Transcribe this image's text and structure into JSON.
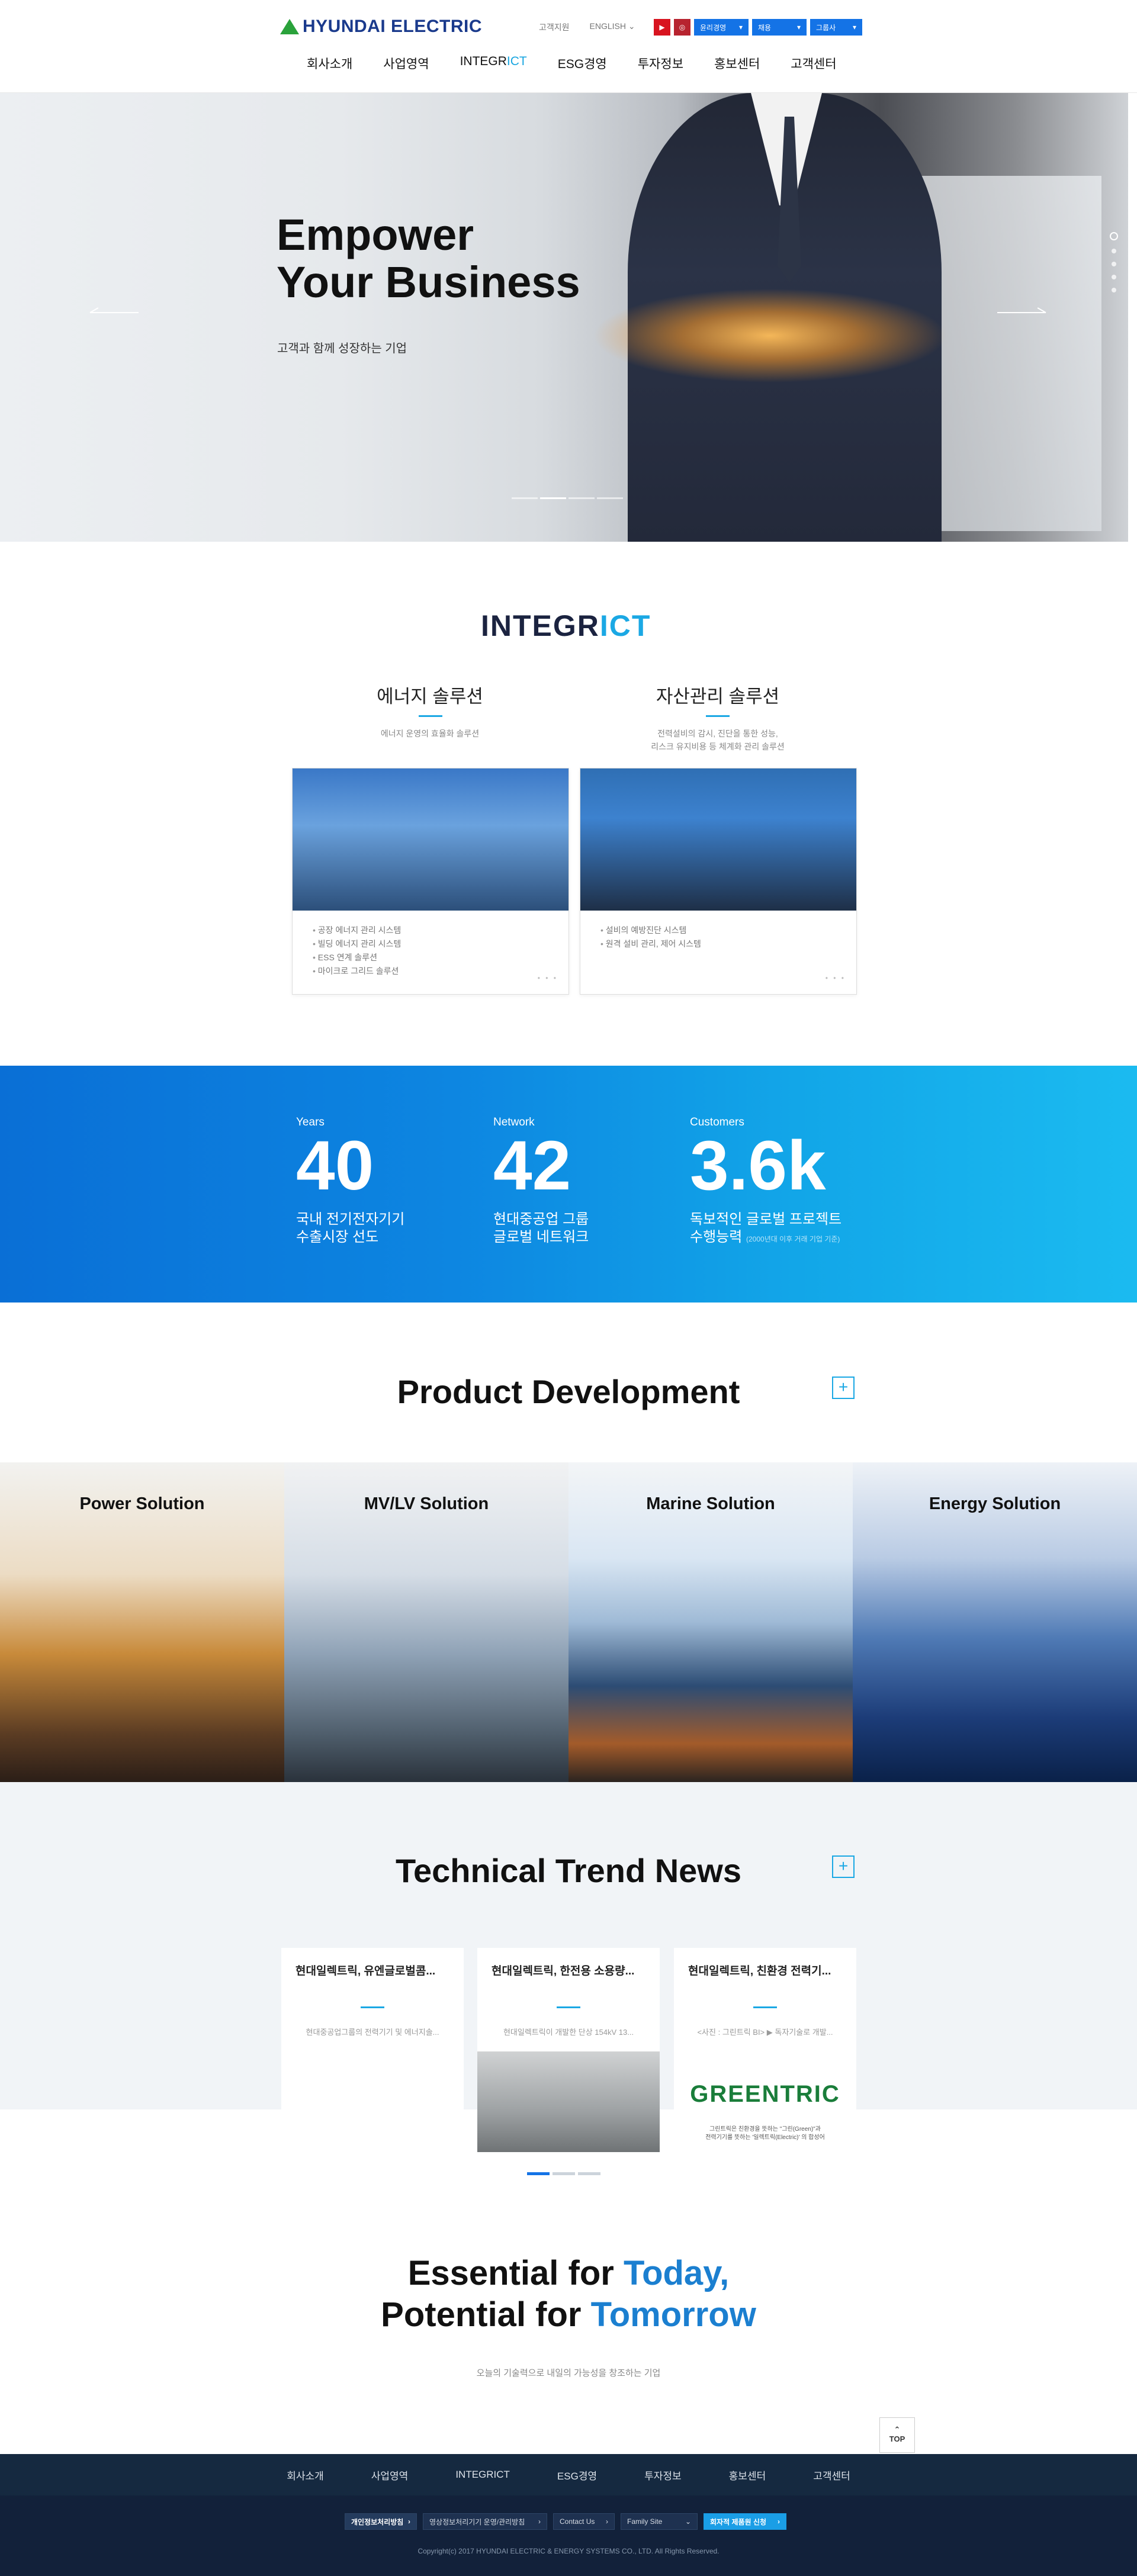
{
  "header": {
    "logo": "HYUNDAI ELECTRIC",
    "util": {
      "support": "고객지원",
      "language": "ENGLISH"
    },
    "sns": {
      "youtube": "▶",
      "instagram": "◎"
    },
    "dropdowns": [
      "윤리경영",
      "채용",
      "그룹사"
    ],
    "nav": [
      "회사소개",
      "사업영역",
      "INTEGR",
      "ICT",
      "ESG경영",
      "투자정보",
      "홍보센터",
      "고객센터"
    ]
  },
  "hero": {
    "title_line1": "Empower",
    "title_line2": "Your Business",
    "subtitle": "고객과 함께 성장하는 기업"
  },
  "integrict": {
    "logo_main": "INTEGR",
    "logo_accent": "ICT",
    "solutions": [
      {
        "title": "에너지 솔루션",
        "desc1": "에너지 운영의 효율화 솔루션",
        "desc2": "",
        "items": [
          "공장 에너지 관리 시스템",
          "빌딩 에너지 관리 시스템",
          "ESS 연계 솔루션",
          "마이크로 그리드 솔루션"
        ],
        "more": "• • •"
      },
      {
        "title": "자산관리 솔루션",
        "desc1": "전력설비의 감시, 진단을 통한 성능,",
        "desc2": "리스크 유지비용 등 체계화 관리 솔루션",
        "items": [
          "설비의 예방진단 시스템",
          "원격 설비 관리, 제어 시스템"
        ],
        "more": "• • •"
      }
    ]
  },
  "stats": [
    {
      "label": "Years",
      "value": "40",
      "desc1": "국내 전기전자기기",
      "desc2": "수출시장 선도",
      "note": ""
    },
    {
      "label": "Network",
      "value": "42",
      "desc1": "현대중공업 그룹",
      "desc2": "글로벌 네트워크",
      "note": ""
    },
    {
      "label": "Customers",
      "value": "3.6k",
      "desc1": "독보적인 글로벌 프로젝트",
      "desc2": "수행능력",
      "note": "(2000년대 이후 거래 기업 기준)"
    }
  ],
  "products": {
    "title": "Product Development",
    "plus": "+",
    "items": [
      "Power Solution",
      "MV/LV Solution",
      "Marine Solution",
      "Energy Solution"
    ]
  },
  "news": {
    "title": "Technical Trend News",
    "plus": "+",
    "items": [
      {
        "title": "현대일렉트릭, 유엔글로벌콤...",
        "desc": "현대중공업그룹의 전력기기 및 에너지솔..."
      },
      {
        "title": "현대일렉트릭, 한전용 소용량...",
        "desc": "현대일렉트릭이 개발한 단상 154kV 13..."
      },
      {
        "title": "현대일렉트릭, 친환경 전력기...",
        "desc": "<사진 : 그린트릭 BI> ▶ 독자기술로 개발..."
      }
    ],
    "greentric": "GREENTRIC",
    "greentric_cap1": "그린트릭은 친환경을 뜻하는 \"그린(Green)\"과",
    "greentric_cap2": "전력기기를 뜻하는 '일렉트릭(Electric)' 의 합성어"
  },
  "essential": {
    "line1_a": "Essential for ",
    "line1_b": "Today,",
    "line2_a": "Potential for ",
    "line2_b": "Tomorrow",
    "sub": "오늘의 기술력으로 내일의 가능성을 창조하는 기업"
  },
  "top_button": {
    "arrow": "⌃",
    "label": "TOP"
  },
  "footer": {
    "nav": [
      "회사소개",
      "사업영역",
      "INTEGRICT",
      "ESG경영",
      "투자정보",
      "홍보센터",
      "고객센터"
    ],
    "buttons": [
      "개인정보처리방침",
      "영상정보처리기기 운영/관리방침",
      "Contact Us",
      "Family Site",
      "회자적 제품원 신청"
    ],
    "copyright": "Copyright(c) 2017 HYUNDAI ELECTRIC & ENERGY SYSTEMS CO., LTD. All Rights Reserved."
  },
  "colors": {
    "accent": "#1ba8e4",
    "brand": "#1a3a8c",
    "footer": "#152940",
    "stats_blue": "#0d86e1"
  }
}
